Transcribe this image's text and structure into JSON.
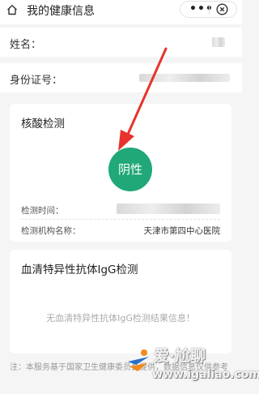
{
  "nav": {
    "title": "我的健康信息",
    "more_glyph": "•••"
  },
  "info": {
    "name_label": "姓名：",
    "id_label": "身份证号："
  },
  "nucleic": {
    "title": "核酸检测",
    "result": "阴性",
    "time_label": "检测时间：",
    "org_label": "检测机构名称：",
    "org_value": "天津市第四中心医院"
  },
  "antibody": {
    "title": "血清特异性抗体IgG检测",
    "empty_text": "无血清特异性抗体IgG检测结果信息！"
  },
  "footnote": "注：本服务基于国家卫生健康委员会提供，数据信息仅供参考",
  "watermark": {
    "text": "爱·尬聊",
    "url": "www.igaliao.com"
  },
  "colors": {
    "negative_badge": "#21a878",
    "arrow": "#e8322c"
  }
}
